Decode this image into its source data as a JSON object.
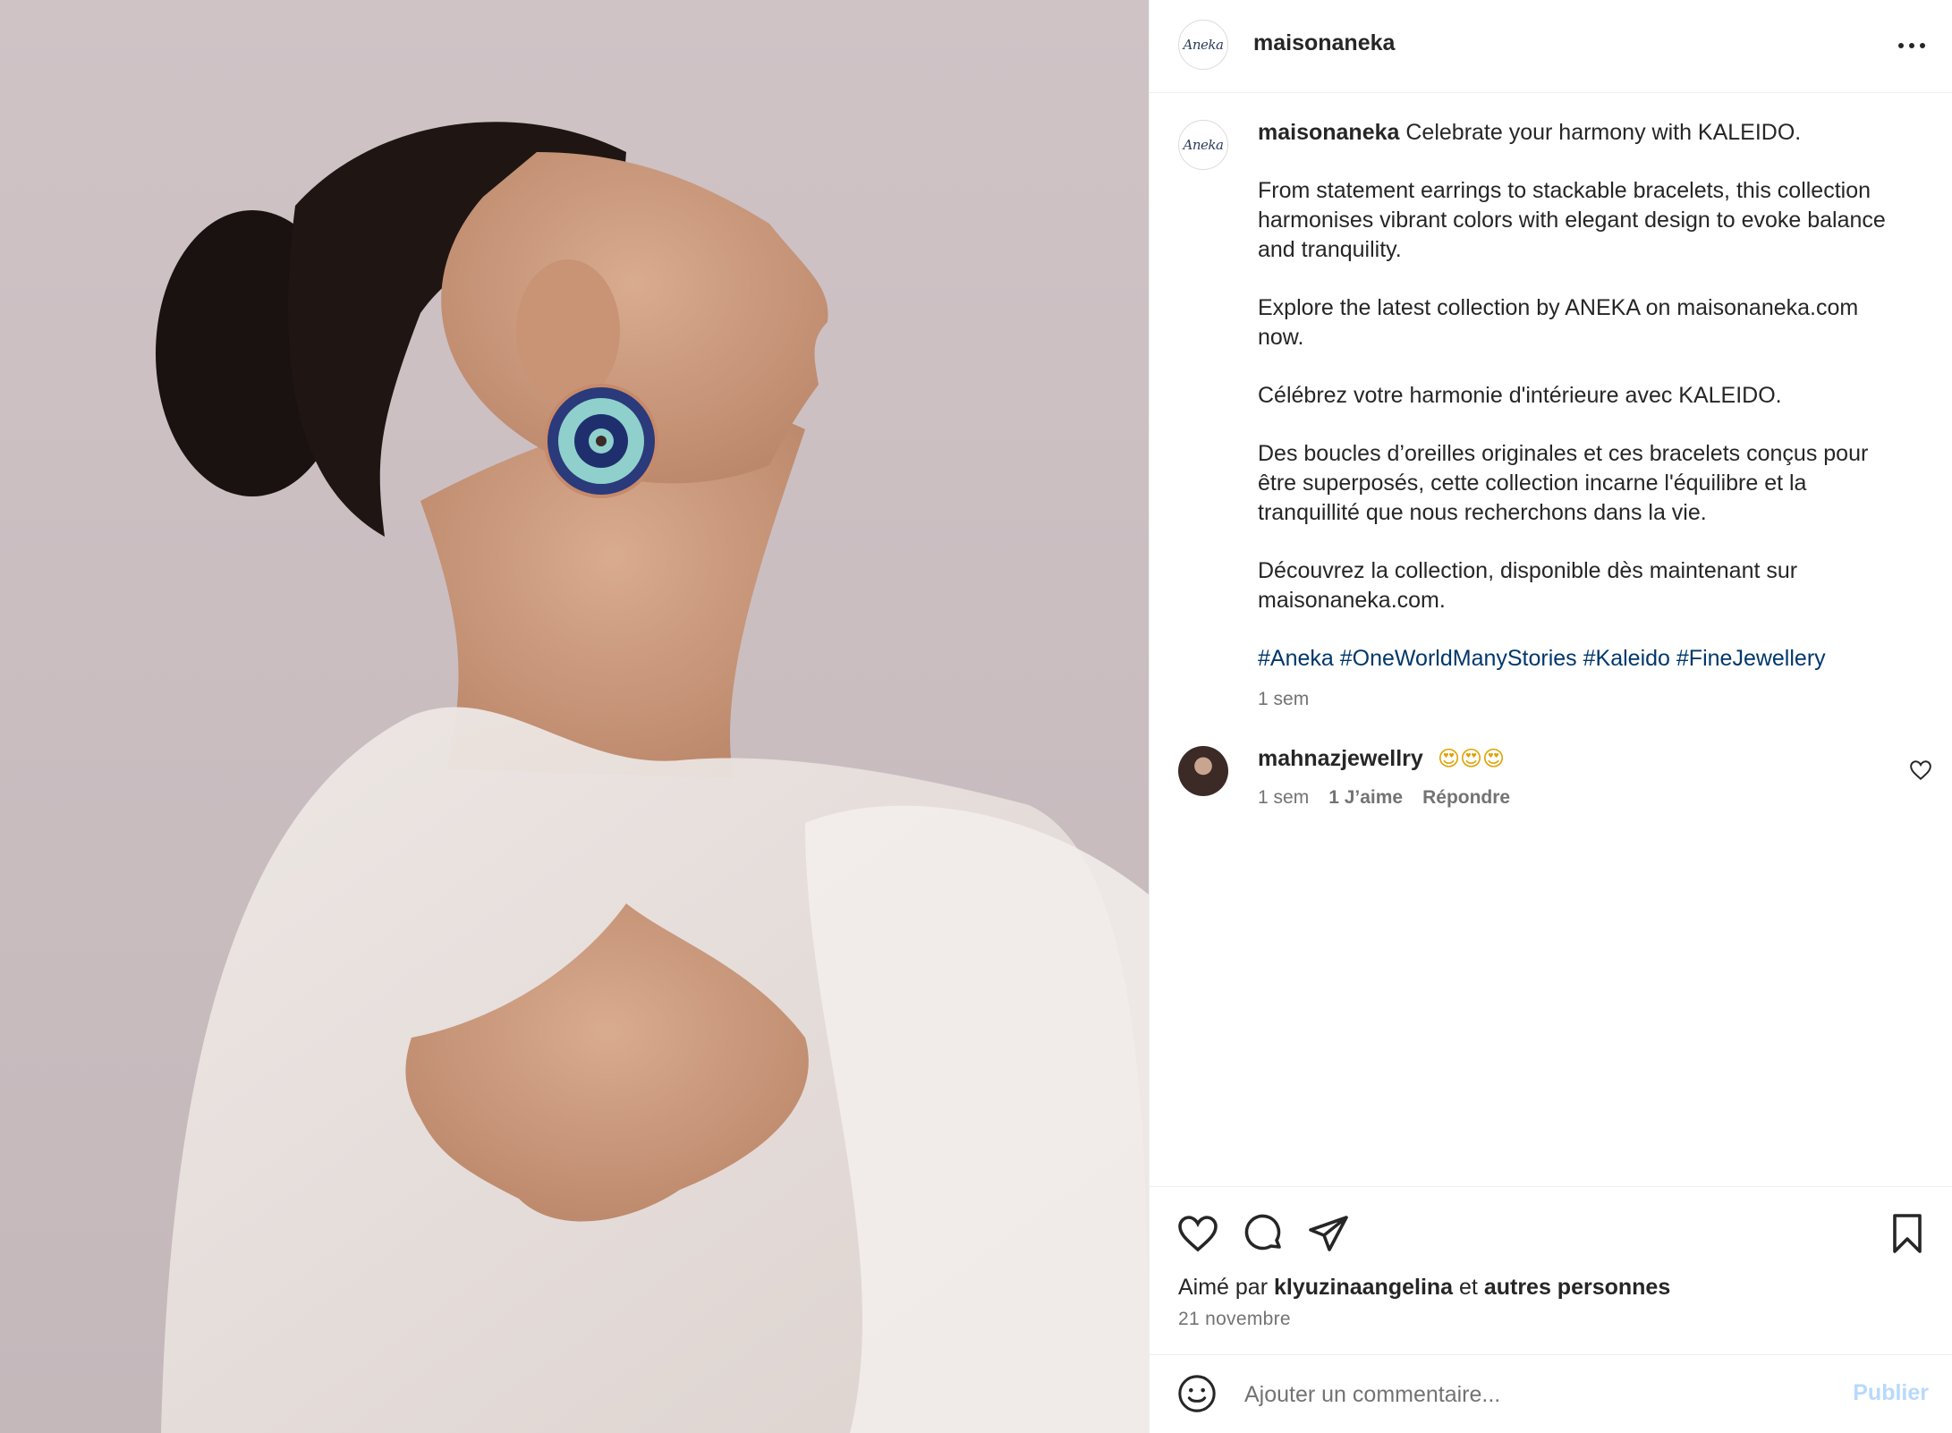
{
  "post": {
    "author": "maisonaneka",
    "avatar_logo_text": "Aneka",
    "more_icon": "more-horizontal-icon"
  },
  "caption": {
    "username": "maisonaneka",
    "first_line": "Celebrate your harmony with KALEIDO.",
    "paragraphs": [
      "From statement earrings to stackable bracelets, this collection harmonises vibrant colors with elegant design to evoke balance and tranquility.",
      "Explore the latest collection by ANEKA on maisonaneka.com now.",
      "Célébrez votre harmonie d'intérieure avec KALEIDO.",
      "Des boucles d’oreilles originales et ces bracelets conçus pour être superposés, cette collection incarne l'équilibre et la tranquillité que nous recherchons dans la vie.",
      "Découvrez la collection, disponible dès maintenant sur maisonaneka.com."
    ],
    "hashtags": [
      "#Aneka",
      "#OneWorldManyStories",
      "#Kaleido",
      "#FineJewellery"
    ],
    "timestamp": "1 sem"
  },
  "comment": {
    "username": "mahnazjewellry",
    "text": "😍😍😍",
    "timestamp": "1 sem",
    "likes": "1 J’aime",
    "reply": "Répondre"
  },
  "actions": {
    "liked_prefix": "Aimé par",
    "liked_user": "klyuzinaangelina",
    "liked_and": "et",
    "liked_others": "autres personnes",
    "date": "21 novembre"
  },
  "composer": {
    "placeholder": "Ajouter un commentaire...",
    "publish_label": "Publier"
  },
  "colors": {
    "link": "#00376b",
    "secondary_text": "#737373",
    "publish_disabled": "#b8d9fb",
    "divider": "#efefef"
  }
}
